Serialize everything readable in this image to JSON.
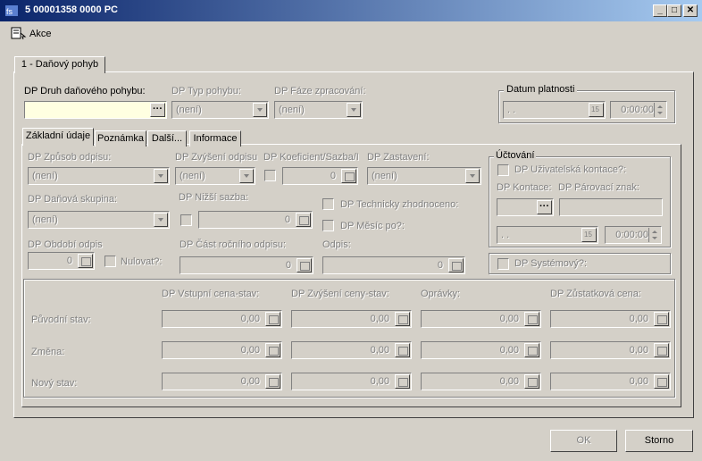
{
  "window": {
    "title": "5 00001358 0000 PC",
    "min": "_",
    "max": "□",
    "close": "✕"
  },
  "menu": {
    "akce": "Akce"
  },
  "main_tab": "1 - Daňový pohyb",
  "druh": {
    "label": "DP Druh daňového pohybu:",
    "value": "",
    "button": "···"
  },
  "typ": {
    "label": "DP Typ pohybu:",
    "value": "(není)"
  },
  "faze": {
    "label": "DP Fáze zpracování:",
    "value": "(není)"
  },
  "datum": {
    "label": "Datum platnosti",
    "date": " .  .",
    "time": "0:00:00",
    "cal": "15"
  },
  "tabs": [
    "Základní údaje",
    "Poznámka",
    "Další...",
    "Informace"
  ],
  "zpusob": {
    "label": "DP Způsob odpisu:",
    "value": "(není)"
  },
  "zvyseni": {
    "label": "DP Zvýšení odpisu",
    "value": "(není)"
  },
  "koef": {
    "label": "DP Koeficient/Sazba/I",
    "value": "0"
  },
  "zastaveni": {
    "label": "DP Zastavení:",
    "value": "(není)"
  },
  "skupina": {
    "label": "DP Daňová skupina:",
    "value": "(není)"
  },
  "nizsi": {
    "label": "DP Nižší sazba:",
    "value": "0"
  },
  "tech": {
    "label": "DP Technicky zhodnoceno:"
  },
  "mesic": {
    "label": "DP Měsíc po?:"
  },
  "obdobi": {
    "label": "DP Období odpis",
    "value": "0"
  },
  "nulovat": {
    "label": "Nulovat?:"
  },
  "cast": {
    "label": "DP Část ročního odpisu:",
    "value": "0"
  },
  "odpis": {
    "label": "Odpis:",
    "value": "0"
  },
  "uctovani": {
    "title": "Účtování",
    "uziv": "DP Uživatelská kontace?:",
    "kontace": "DP Kontace:",
    "parovaci": "DP Párovací znak:",
    "kontace_btn": "···",
    "date": " .  .",
    "time": "0:00:00",
    "cal": "15"
  },
  "systemovy": {
    "label": "DP Systémový?:"
  },
  "grid": {
    "headers": [
      "DP Vstupní cena-stav:",
      "DP Zvýšení ceny-stav:",
      "Oprávky:",
      "DP Zůstatková cena:"
    ],
    "rows": [
      {
        "label": "Původní stav:",
        "values": [
          "0,00",
          "0,00",
          "0,00",
          "0,00"
        ]
      },
      {
        "label": "Změna:",
        "values": [
          "0,00",
          "0,00",
          "0,00",
          "0,00"
        ]
      },
      {
        "label": "Nový stav:",
        "values": [
          "0,00",
          "0,00",
          "0,00",
          "0,00"
        ]
      }
    ]
  },
  "buttons": {
    "ok": "OK",
    "storno": "Storno"
  }
}
